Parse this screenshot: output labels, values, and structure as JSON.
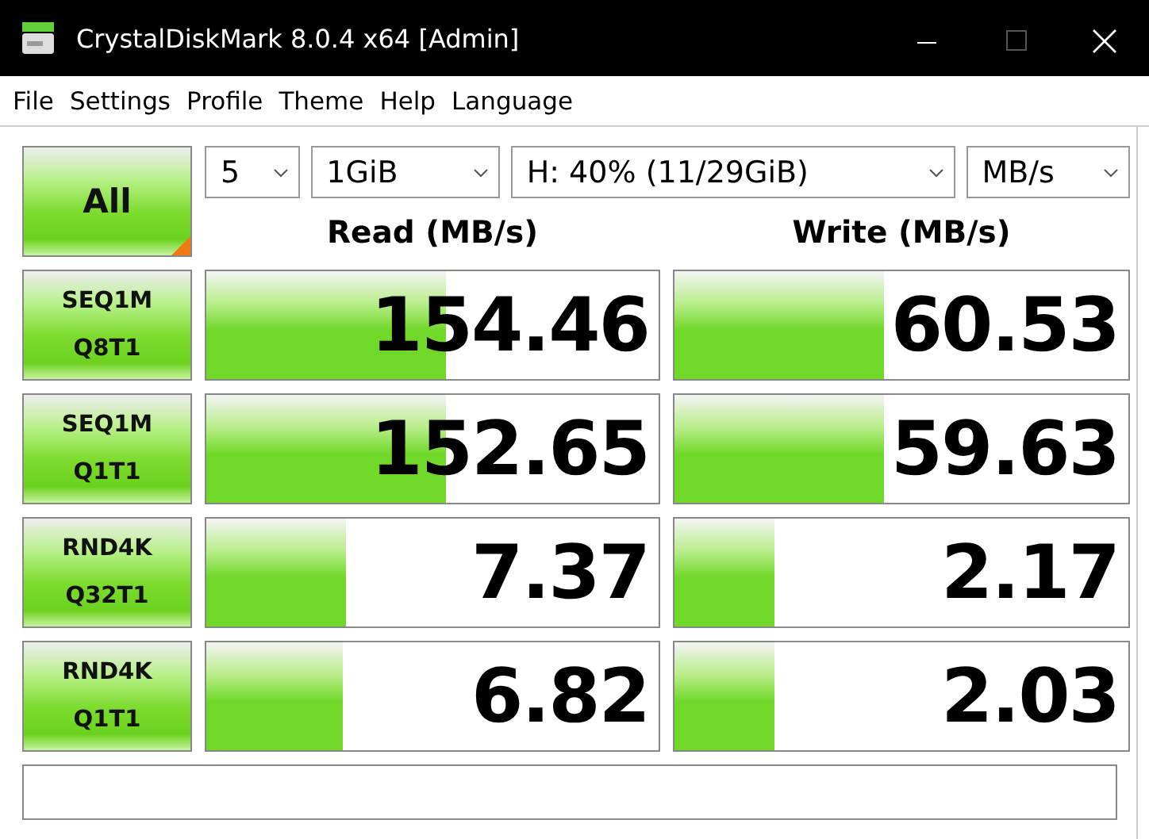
{
  "window": {
    "title": "CrystalDiskMark 8.0.4 x64 [Admin]"
  },
  "menu": [
    "File",
    "Settings",
    "Profile",
    "Theme",
    "Help",
    "Language"
  ],
  "all_button": {
    "label": "All"
  },
  "settings": [
    {
      "value": "5"
    },
    {
      "value": "1GiB"
    },
    {
      "value": "H: 40% (11/29GiB)"
    },
    {
      "value": "MB/s"
    }
  ],
  "headers": {
    "read": "Read (MB/s)",
    "write": "Write (MB/s)"
  },
  "tests": [
    {
      "name": "SEQ1M",
      "queue": "Q8T1",
      "read": {
        "value": "154.46",
        "level": 0.53
      },
      "write": {
        "value": "60.53",
        "level": 0.46
      }
    },
    {
      "name": "SEQ1M",
      "queue": "Q1T1",
      "read": {
        "value": "152.65",
        "level": 0.53
      },
      "write": {
        "value": "59.63",
        "level": 0.46
      }
    },
    {
      "name": "RND4K",
      "queue": "Q32T1",
      "read": {
        "value": "7.37",
        "level": 0.31
      },
      "write": {
        "value": "2.17",
        "level": 0.22
      }
    },
    {
      "name": "RND4K",
      "queue": "Q1T1",
      "read": {
        "value": "6.82",
        "level": 0.3
      },
      "write": {
        "value": "2.03",
        "level": 0.22
      }
    }
  ]
}
